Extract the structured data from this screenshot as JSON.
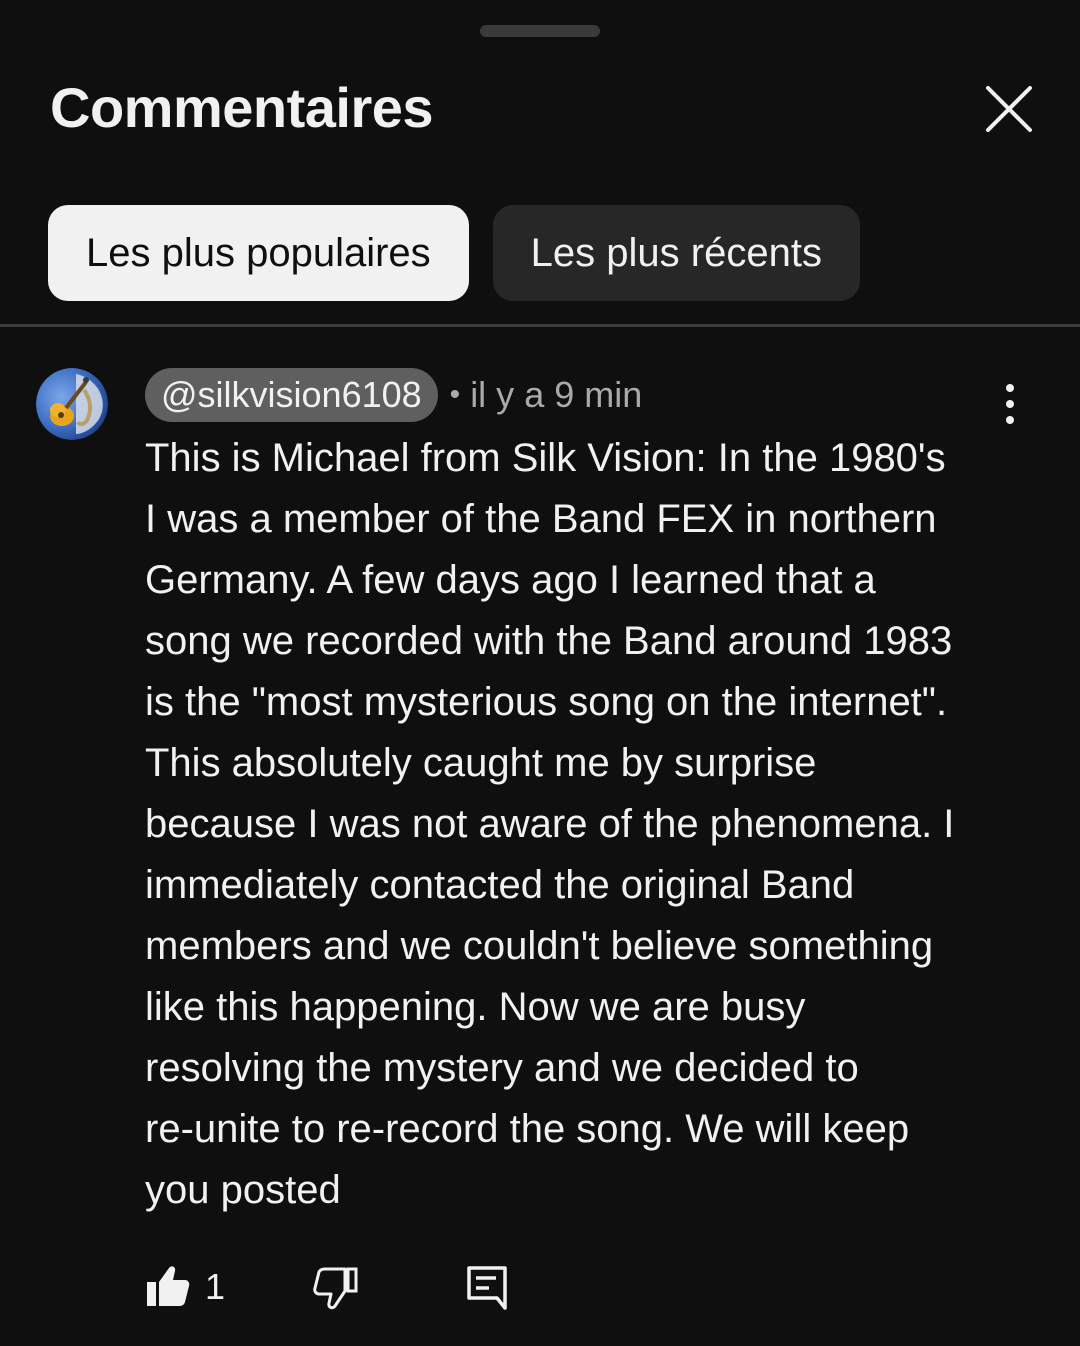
{
  "panel": {
    "title": "Commentaires",
    "close_icon": "close-icon"
  },
  "sort_chips": [
    {
      "label": "Les plus populaires",
      "active": true
    },
    {
      "label": "Les plus récents",
      "active": false
    }
  ],
  "comment": {
    "author_handle": "@silkvision6108",
    "timestamp": "il y a 9 min",
    "separator": "•",
    "text": "This is Michael from Silk Vision: In the 1980's\nI was a member of the Band FEX in northern\nGermany. A few days ago I learned that a\nsong we recorded with the Band around 1983\nis the \"most mysterious song on the internet\".\nThis absolutely caught me by surprise\nbecause I was not aware of the phenomena. I\nimmediately contacted the original Band\nmembers and we couldn't believe something\nlike this happening. Now we are busy\nresolving the mystery and we decided to\nre-unite to re-record the song. We will keep\nyou posted",
    "like_count": "1",
    "icons": {
      "avatar": "guitar-saxophone-avatar",
      "more": "more-vert-icon",
      "like": "thumbs-up-filled-icon",
      "dislike": "thumbs-down-icon",
      "reply": "reply-comment-icon"
    }
  },
  "colors": {
    "background": "#0f0f0f",
    "text": "#f1f1f1",
    "secondary_text": "#aaaaaa",
    "chip_active_bg": "#f1f1f1",
    "chip_inactive_bg": "#272727",
    "handle_pill_bg": "#5f5f5f"
  }
}
